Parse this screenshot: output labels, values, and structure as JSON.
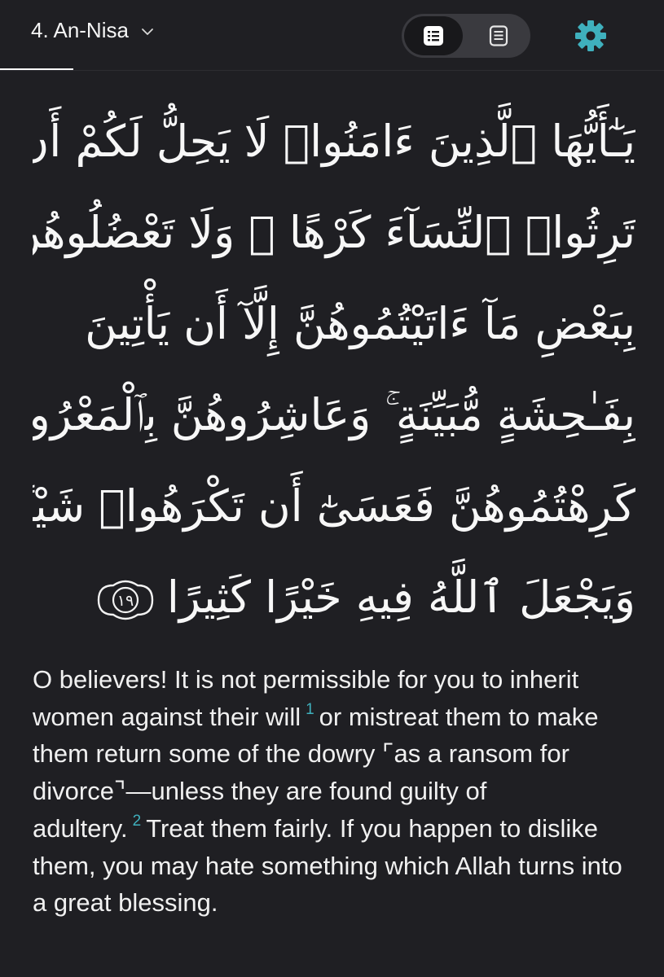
{
  "header": {
    "surah_title": "4. An-Nisa",
    "accent_color": "#3fb0bd"
  },
  "verse": {
    "number": "١٩",
    "arabic_lines": [
      "يَـٰٓأَيُّهَا ٱلَّذِينَ ءَامَنُوا۟ لَا يَحِلُّ لَكُمْ أَن",
      "تَرِثُوا۟ ٱلنِّسَآءَ كَرْهًا ۖ وَلَا تَعْضُلُوهُنَّ لِتَذْهَبُوا۟",
      "بِبَعْضِ مَآ ءَاتَيْتُمُوهُنَّ إِلَّآ أَن يَأْتِينَ",
      "بِفَـٰحِشَةٍ مُّبَيِّنَةٍ ۚ وَعَاشِرُوهُنَّ بِٱلْمَعْرُوفِ ۚ فَإِن",
      "كَرِهْتُمُوهُنَّ فَعَسَىٰٓ أَن تَكْرَهُوا۟ شَيْـًٔا",
      "وَيَجْعَلَ ٱللَّهُ فِيهِ خَيْرًا كَثِيرًا"
    ]
  },
  "translation": {
    "part1": "O believers! It is not permissible for you to inherit women against their will",
    "footnote1": "1",
    "part2": "or mistreat them to make them return some of the dowry ⌜as a ransom for divorce⌝—unless they are found guilty of adultery.",
    "footnote2": "2",
    "part3": "Treat them fairly. If you happen to dislike them, you may hate something which Allah turns into a great blessing."
  }
}
